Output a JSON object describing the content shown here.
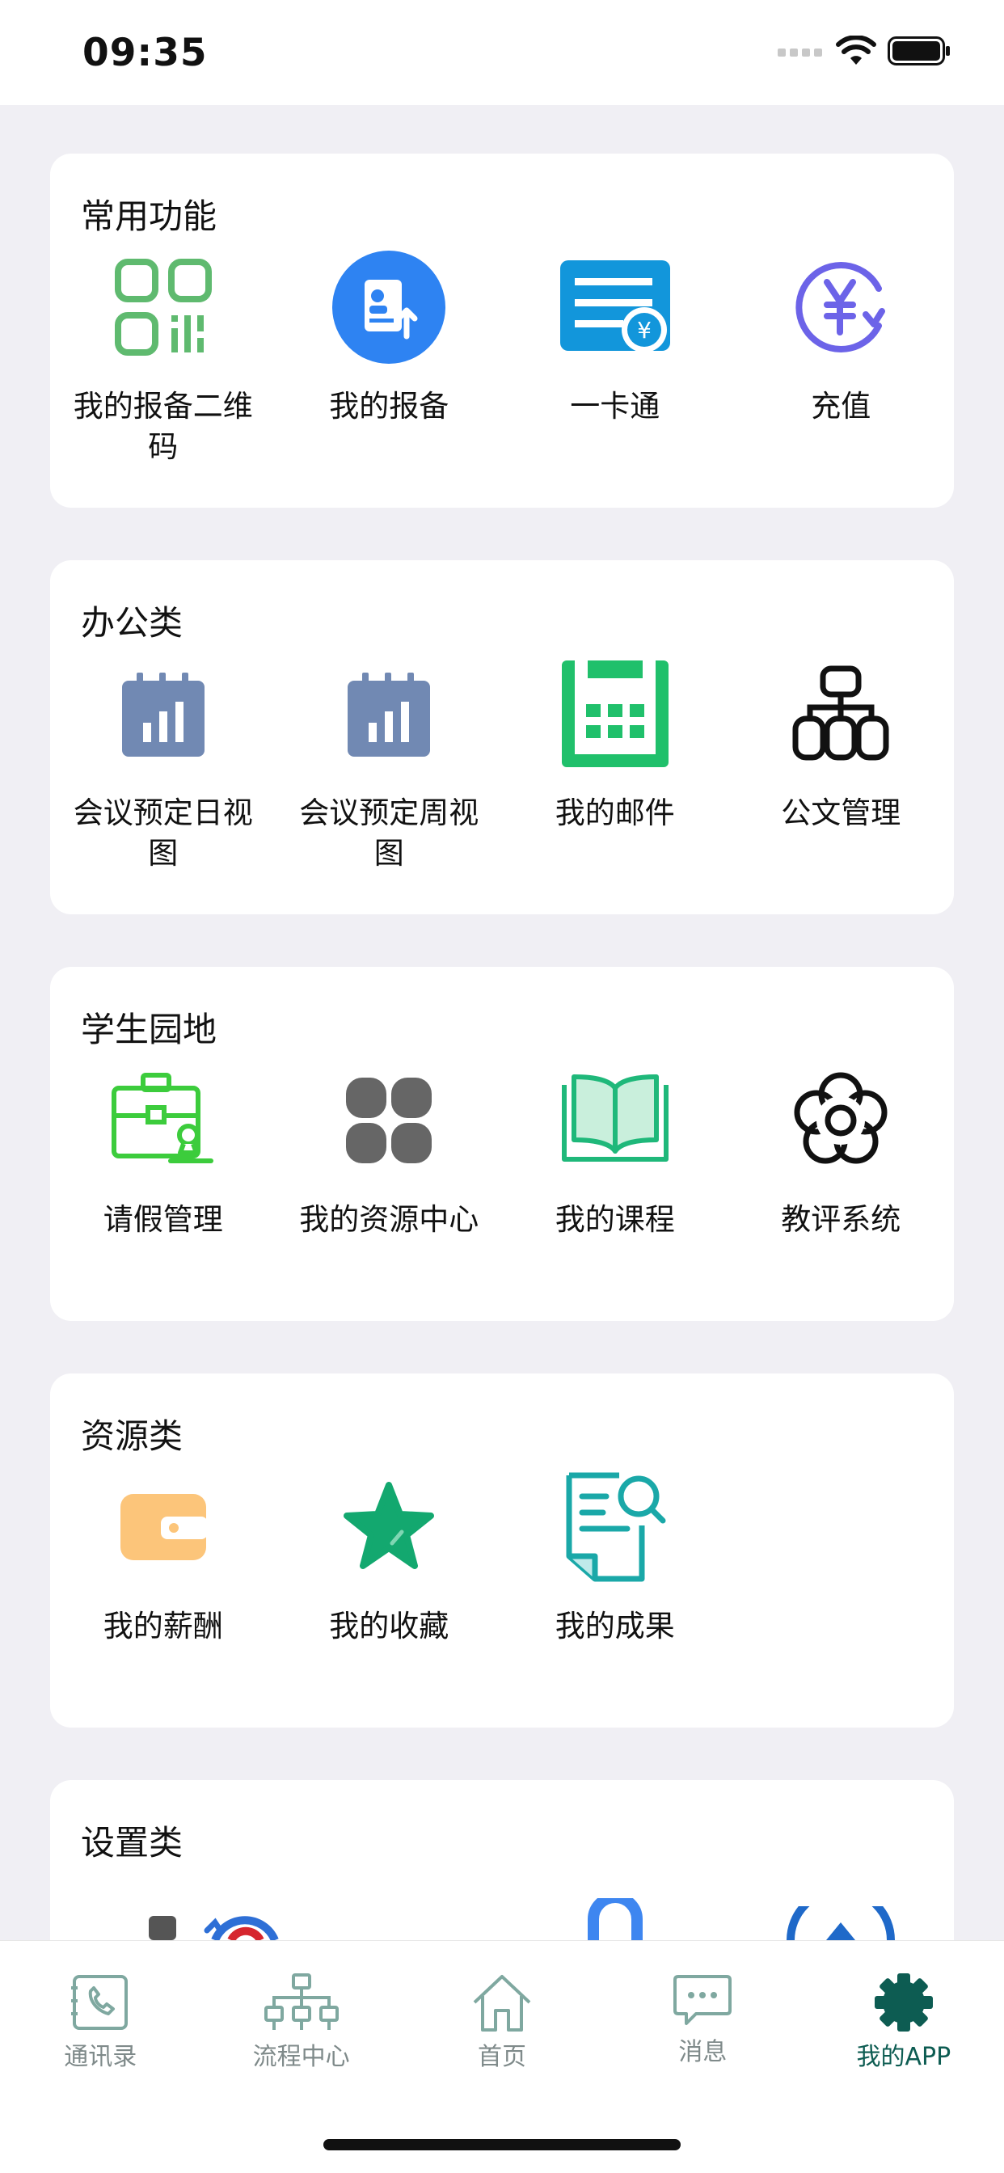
{
  "status_bar": {
    "time": "09:35"
  },
  "sections": [
    {
      "title": "常用功能",
      "items": [
        {
          "label": "我的报备二维码",
          "icon": "qr-code-icon"
        },
        {
          "label": "我的报备",
          "icon": "report-upload-icon"
        },
        {
          "label": "一卡通",
          "icon": "campus-card-icon"
        },
        {
          "label": "充值",
          "icon": "recharge-yen-icon"
        }
      ]
    },
    {
      "title": "办公类",
      "items": [
        {
          "label": "会议预定日视图",
          "icon": "calendar-chart-icon"
        },
        {
          "label": "会议预定周视图",
          "icon": "calendar-chart-icon"
        },
        {
          "label": "我的邮件",
          "icon": "calendar-grid-icon"
        },
        {
          "label": "公文管理",
          "icon": "org-chart-icon"
        }
      ]
    },
    {
      "title": "学生园地",
      "items": [
        {
          "label": "请假管理",
          "icon": "briefcase-stamp-icon"
        },
        {
          "label": "我的资源中心",
          "icon": "four-squares-icon"
        },
        {
          "label": "我的课程",
          "icon": "open-book-icon"
        },
        {
          "label": "教评系统",
          "icon": "flower-icon"
        }
      ]
    },
    {
      "title": "资源类",
      "items": [
        {
          "label": "我的薪酬",
          "icon": "wallet-icon"
        },
        {
          "label": "我的收藏",
          "icon": "star-icon"
        },
        {
          "label": "我的成果",
          "icon": "document-search-icon"
        }
      ]
    },
    {
      "title": "设置类",
      "items": []
    }
  ],
  "tab_bar": {
    "tabs": [
      {
        "label": "通讯录",
        "icon": "contacts-phone-icon"
      },
      {
        "label": "流程中心",
        "icon": "flow-tree-icon"
      },
      {
        "label": "首页",
        "icon": "home-icon"
      },
      {
        "label": "消息",
        "icon": "message-bubble-icon"
      },
      {
        "label": "我的APP",
        "icon": "gear-icon"
      }
    ],
    "active": "我的APP",
    "active_color": "#0d5c52",
    "inactive_color": "#7f8a8a"
  }
}
